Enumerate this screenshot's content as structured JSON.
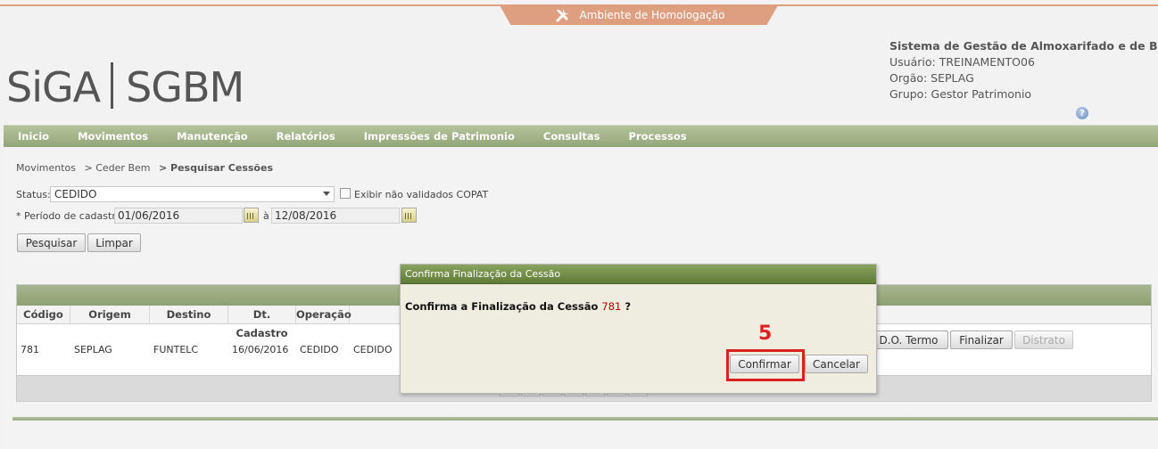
{
  "env": {
    "label": "Ambiente de Homologação",
    "icon": "tools-icon"
  },
  "logo": {
    "left": "SiGA",
    "right": "SGBM"
  },
  "sysinfo": {
    "title": "Sistema de Gestão de Almoxarifado e de Bens",
    "user": "Usuário: TREINAMENTO06",
    "org": "Orgão: SEPLAG",
    "group": "Grupo: Gestor Patrimonio",
    "help_icon": "?"
  },
  "menu": [
    "Inicio",
    "Movimentos",
    "Manutenção",
    "Relatórios",
    "Impressões de Patrimonio",
    "Consultas",
    "Processos"
  ],
  "breadcrumb": [
    "Movimentos",
    "> Ceder Bem",
    "> Pesquisar Cessões"
  ],
  "form": {
    "status_label": "Status:",
    "status_value": "CEDIDO",
    "checkbox_label": "Exibir não validados COPAT",
    "period_label": "* Período de cadastro:",
    "date_from": "01/06/2016",
    "date_sep": "à",
    "date_to": "12/08/2016",
    "search_btn": "Pesquisar",
    "clear_btn": "Limpar"
  },
  "table": {
    "headers": [
      "Código",
      "Origem",
      "Destino",
      "Dt. Cadastro",
      "Operação"
    ],
    "row": [
      "781",
      "SEPLAG",
      "FUNTELC",
      "16/06/2016",
      "CEDIDO",
      "CEDIDO"
    ],
    "actions": {
      "termo": "D.O. Termo",
      "finalizar": "Finalizar",
      "distrato": "Distrato"
    }
  },
  "dialog": {
    "title": "Confirma Finalização da Cessão",
    "msg_prefix": "Confirma a Finalização da Cessão",
    "msg_number": "781",
    "msg_suffix": "?",
    "confirm": "Confirmar",
    "cancel": "Cancelar"
  },
  "annotation": {
    "step": "5",
    "color": "#d9211f"
  }
}
